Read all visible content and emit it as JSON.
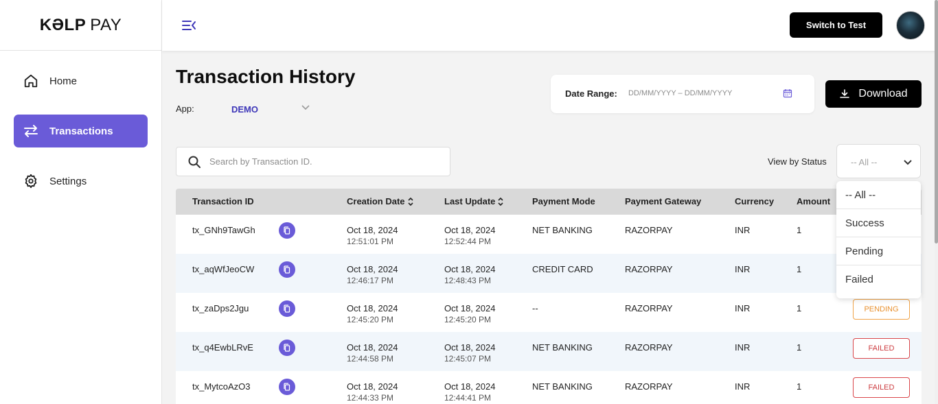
{
  "brand": {
    "logo_bold": "KƏLP",
    "logo_light": "PAY"
  },
  "sidebar": {
    "items": [
      {
        "label": "Home",
        "icon": "home-icon"
      },
      {
        "label": "Transactions",
        "icon": "transfer-arrows-icon",
        "active": true
      },
      {
        "label": "Settings",
        "icon": "gear-icon"
      }
    ]
  },
  "header": {
    "switch_label": "Switch to Test"
  },
  "page": {
    "title": "Transaction History",
    "app_label": "App:",
    "app_value": "DEMO",
    "date_range_label": "Date Range:",
    "date_range_placeholder": "DD/MM/YYYY – DD/MM/YYYY",
    "download_label": "Download",
    "search_placeholder": "Search by Transaction ID.",
    "status_label": "View by Status",
    "status_value": "-- All --"
  },
  "status_options": [
    "-- All --",
    "Success",
    "Pending",
    "Failed"
  ],
  "table": {
    "headers": {
      "id": "Transaction ID",
      "created": "Creation Date",
      "updated": "Last Update",
      "mode": "Payment Mode",
      "gateway": "Payment Gateway",
      "currency": "Currency",
      "amount": "Amount"
    },
    "rows": [
      {
        "id": "tx_GNh9TawGh",
        "created_date": "Oct 18, 2024",
        "created_time": "12:51:01 PM",
        "updated_date": "Oct 18, 2024",
        "updated_time": "12:52:44 PM",
        "mode": "NET BANKING",
        "gateway": "RAZORPAY",
        "currency": "INR",
        "amount": "1",
        "status": ""
      },
      {
        "id": "tx_aqWfJeoCW",
        "created_date": "Oct 18, 2024",
        "created_time": "12:46:17 PM",
        "updated_date": "Oct 18, 2024",
        "updated_time": "12:48:43 PM",
        "mode": "CREDIT CARD",
        "gateway": "RAZORPAY",
        "currency": "INR",
        "amount": "1",
        "status": ""
      },
      {
        "id": "tx_zaDps2Jgu",
        "created_date": "Oct 18, 2024",
        "created_time": "12:45:20 PM",
        "updated_date": "Oct 18, 2024",
        "updated_time": "12:45:20 PM",
        "mode": "--",
        "gateway": "RAZORPAY",
        "currency": "INR",
        "amount": "1",
        "status": "PENDING"
      },
      {
        "id": "tx_q4EwbLRvE",
        "created_date": "Oct 18, 2024",
        "created_time": "12:44:58 PM",
        "updated_date": "Oct 18, 2024",
        "updated_time": "12:45:07 PM",
        "mode": "NET BANKING",
        "gateway": "RAZORPAY",
        "currency": "INR",
        "amount": "1",
        "status": "FAILED"
      },
      {
        "id": "tx_MytcoAzO3",
        "created_date": "Oct 18, 2024",
        "created_time": "12:44:33 PM",
        "updated_date": "Oct 18, 2024",
        "updated_time": "12:44:41 PM",
        "mode": "NET BANKING",
        "gateway": "RAZORPAY",
        "currency": "INR",
        "amount": "1",
        "status": "FAILED"
      }
    ]
  },
  "colors": {
    "accent": "#6a5bd8",
    "app_value": "#3d36b8",
    "pending": "#e8902e",
    "failed": "#cc3b3f"
  }
}
